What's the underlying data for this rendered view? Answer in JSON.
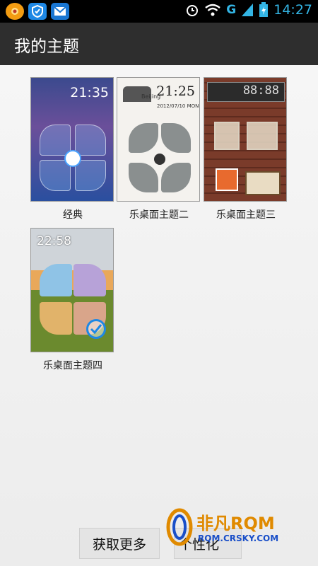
{
  "status_bar": {
    "time": "14:27",
    "network": "G",
    "icons": [
      "sunflower-app-icon",
      "shield-icon",
      "envelope-icon",
      "alarm-icon",
      "wifi-icon",
      "signal-icon",
      "battery-icon"
    ]
  },
  "header": {
    "title": "我的主题"
  },
  "themes": [
    {
      "label": "经典",
      "preview_time": "21:35",
      "selected": false
    },
    {
      "label": "乐桌面主题二",
      "preview_time": "21:25",
      "preview_city": "Beijing",
      "preview_date": "2012/07/10 MON",
      "selected": false
    },
    {
      "label": "乐桌面主题三",
      "preview_time": "88:88",
      "selected": false
    },
    {
      "label": "乐桌面主题四",
      "preview_time": "22:58",
      "selected": true
    }
  ],
  "buttons": {
    "more": "获取更多",
    "custom": "个性化"
  },
  "watermark": {
    "name": "非凡RQM",
    "url": "RQM.CRSKY.COM"
  },
  "colors": {
    "accent": "#33b5e5",
    "action_bar": "#2e2e2e",
    "status_bar": "#000000"
  }
}
